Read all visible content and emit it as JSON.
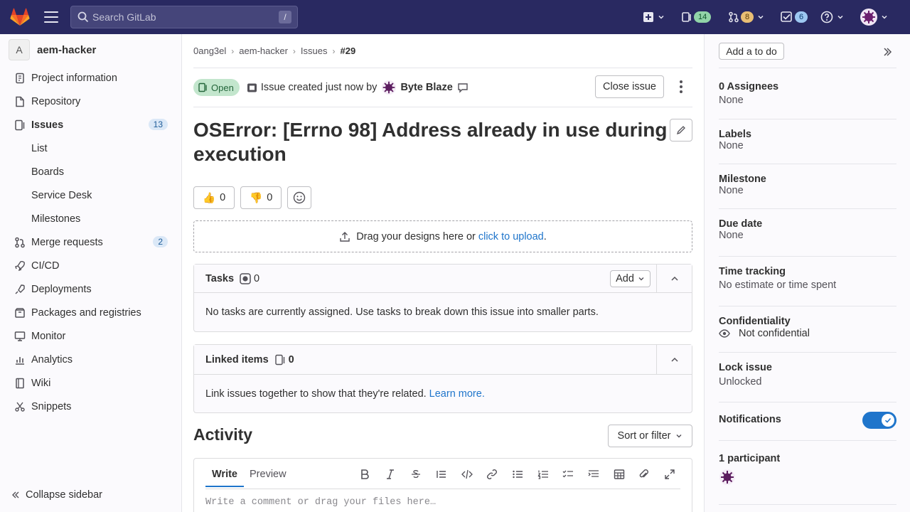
{
  "topbar": {
    "search_placeholder": "Search GitLab",
    "search_shortcut": "/",
    "mr_count": "14",
    "review_count": "8",
    "todo_count": "6",
    "accent": "#292961"
  },
  "sidebar": {
    "project_initial": "A",
    "project_name": "aem-hacker",
    "items": [
      {
        "label": "Project information",
        "icon": "info-icon"
      },
      {
        "label": "Repository",
        "icon": "doc-icon"
      },
      {
        "label": "Issues",
        "icon": "issues-icon",
        "count": "13"
      },
      {
        "label": "List"
      },
      {
        "label": "Boards"
      },
      {
        "label": "Service Desk"
      },
      {
        "label": "Milestones"
      },
      {
        "label": "Merge requests",
        "icon": "merge-request-icon",
        "count": "2"
      },
      {
        "label": "CI/CD",
        "icon": "rocket-icon"
      },
      {
        "label": "Deployments",
        "icon": "deploy-icon"
      },
      {
        "label": "Packages and registries",
        "icon": "package-icon"
      },
      {
        "label": "Monitor",
        "icon": "monitor-icon"
      },
      {
        "label": "Analytics",
        "icon": "chart-icon"
      },
      {
        "label": "Wiki",
        "icon": "book-icon"
      },
      {
        "label": "Snippets",
        "icon": "snippet-icon"
      }
    ],
    "collapse_label": "Collapse sidebar"
  },
  "breadcrumb": [
    "0ang3el",
    "aem-hacker",
    "Issues",
    "#29"
  ],
  "issue": {
    "status": "Open",
    "created_text": "Issue created just now by",
    "author": "Byte Blaze",
    "close_label": "Close issue",
    "title": "OSError: [Errno 98] Address already in use during execution",
    "thumbs_up": "0",
    "thumbs_down": "0",
    "thumbs_up_emoji": "👍",
    "thumbs_down_emoji": "👎"
  },
  "upload": {
    "text": "Drag your designs here or",
    "link": "click to upload",
    "end": "."
  },
  "tasks": {
    "title": "Tasks",
    "count": "0",
    "add_label": "Add",
    "empty_text": "No tasks are currently assigned. Use tasks to break down this issue into smaller parts."
  },
  "linked": {
    "title": "Linked items",
    "count": "0",
    "text": "Link issues together to show that they're related.",
    "link": "Learn more."
  },
  "activity": {
    "title": "Activity",
    "sort_label": "Sort or filter",
    "tab_write": "Write",
    "tab_preview": "Preview",
    "placeholder": "Write a comment or drag your files here…"
  },
  "right": {
    "add_todo": "Add a to do",
    "assignees_label": "0 Assignees",
    "assignees_val": "None",
    "labels_label": "Labels",
    "labels_val": "None",
    "milestone_label": "Milestone",
    "milestone_val": "None",
    "due_label": "Due date",
    "due_val": "None",
    "time_label": "Time tracking",
    "time_val": "No estimate or time spent",
    "conf_label": "Confidentiality",
    "conf_val": "Not confidential",
    "lock_label": "Lock issue",
    "lock_val": "Unlocked",
    "notif_label": "Notifications",
    "notif_on": true,
    "participants_label": "1 participant"
  }
}
